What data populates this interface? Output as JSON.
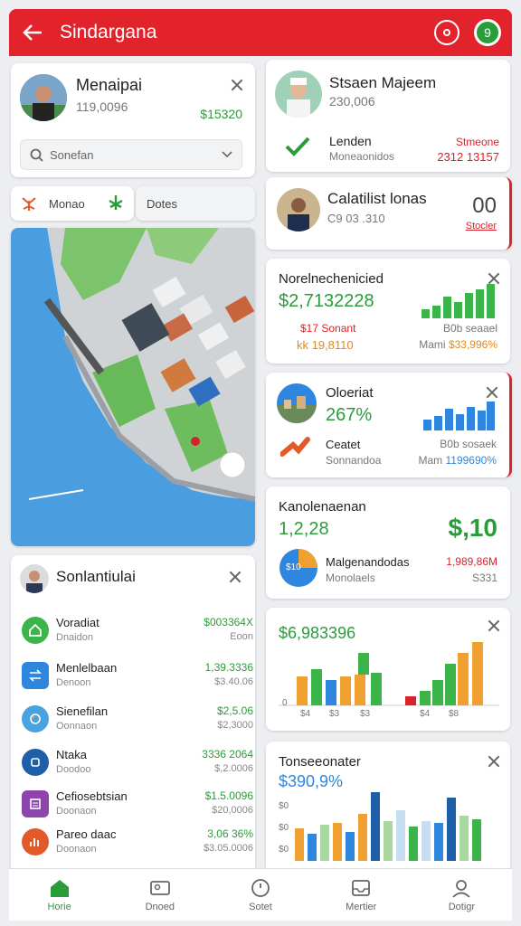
{
  "app": {
    "title": "Sindargana",
    "accent": "#e3232c",
    "green": "#2a9d3a"
  },
  "profile": {
    "name": "Menaipai",
    "sub": "119,0096",
    "amount": "$15320"
  },
  "search": {
    "placeholder": "Sonefan"
  },
  "chips": {
    "first": "Monao",
    "second": "Dotes"
  },
  "right_profile": {
    "name": "Stsaen Majeem",
    "sub": "230,006",
    "label": "Lenden",
    "label_sub": "Moneaonidos",
    "amount": "Stmeone",
    "amount_sub": "2312 13157"
  },
  "card2": {
    "name": "Calatilist lonas",
    "sub": "C9 03 .310",
    "value": "00",
    "link": "Stocler"
  },
  "card3": {
    "title": "Norelnechenicied",
    "value": "$2,7132228",
    "row1_left": "$17 Sonant",
    "row1_right": "B0b seaael",
    "row2_left": "kk 19,8110",
    "row2_right_prefix": "Mami",
    "row2_right": "$33,996%"
  },
  "card4": {
    "title": "Oloeriat",
    "value": "267%",
    "row_label": "Ceatet",
    "row_sub": "Sonnandoa",
    "right_label": "B0b sosaek",
    "right_prefix": "Mam",
    "right_value": "1199690%"
  },
  "card5": {
    "title": "Kanolenaenan",
    "value": "1,2,28",
    "big": "$,10",
    "pie_label": "$10",
    "row_label": "Malgenandodas",
    "row_sub": "Monolaels",
    "row_right": "1,989,86M",
    "row_right_sub": "S331"
  },
  "card6": {
    "value": "$6,983396",
    "x_labels": [
      "$4",
      "$3",
      "$3",
      "$4",
      "$8"
    ],
    "y_zero": "0"
  },
  "card7": {
    "title": "Tonseeonater",
    "value": "$390,9%",
    "y_labels": [
      "$0",
      "$0",
      "$0",
      "$0"
    ]
  },
  "list": {
    "title": "Sonlantiulai",
    "items": [
      {
        "title": "Voradiat",
        "sub": "Dnaidon",
        "amount": "$003364X",
        "amount_sub": "Eoon"
      },
      {
        "title": "Menlelbaan",
        "sub": "Denoon",
        "amount": "1,39.3336",
        "amount_sub": "$3.40.06"
      },
      {
        "title": "Sienefilan",
        "sub": "Oonnaon",
        "amount": "$2,5.06",
        "amount_sub": "$2,3000"
      },
      {
        "title": "Ntaka",
        "sub": "Doodoo",
        "amount": "3336 2064",
        "amount_sub": "$,2.0006"
      },
      {
        "title": "Cefiosebtsian",
        "sub": "Doonaon",
        "amount": "$1.5.0096",
        "amount_sub": "$20,0006"
      },
      {
        "title": "Pareo daac",
        "sub": "Doonaon",
        "amount": "3,06 36%",
        "amount_sub": "$3.05.0006"
      }
    ]
  },
  "nav": [
    {
      "label": "Horie"
    },
    {
      "label": "Dnoed"
    },
    {
      "label": "Sotet"
    },
    {
      "label": "Mertier"
    },
    {
      "label": "Dotigr"
    }
  ]
}
